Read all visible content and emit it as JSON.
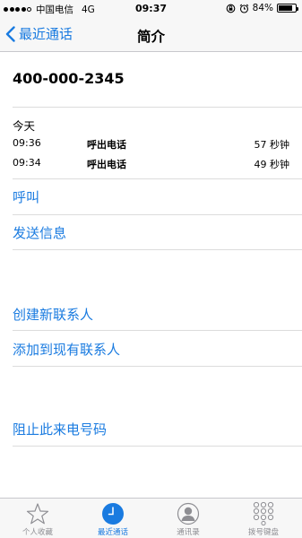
{
  "status_bar": {
    "carrier": "中国电信",
    "network": "4G",
    "time": "09:37",
    "battery_percent": "84%",
    "battery_level": 0.84
  },
  "nav": {
    "back_label": "最近通话",
    "title": "简介"
  },
  "contact": {
    "phone_number": "400-000-2345"
  },
  "call_log": {
    "day_label": "今天",
    "entries": [
      {
        "time": "09:36",
        "type": "呼出电话",
        "duration": "57 秒钟"
      },
      {
        "time": "09:34",
        "type": "呼出电话",
        "duration": "49 秒钟"
      }
    ]
  },
  "actions": {
    "call": "呼叫",
    "send_message": "发送信息",
    "create_contact": "创建新联系人",
    "add_to_existing": "添加到现有联系人",
    "block_caller": "阻止此来电号码"
  },
  "tab_bar": {
    "favorites": "个人收藏",
    "recents": "最近通话",
    "contacts": "通讯录",
    "keypad": "拨号键盘"
  },
  "colors": {
    "accent": "#1a7be0",
    "inactive": "#8e8e93",
    "bar_background": "#f7f7f7"
  }
}
